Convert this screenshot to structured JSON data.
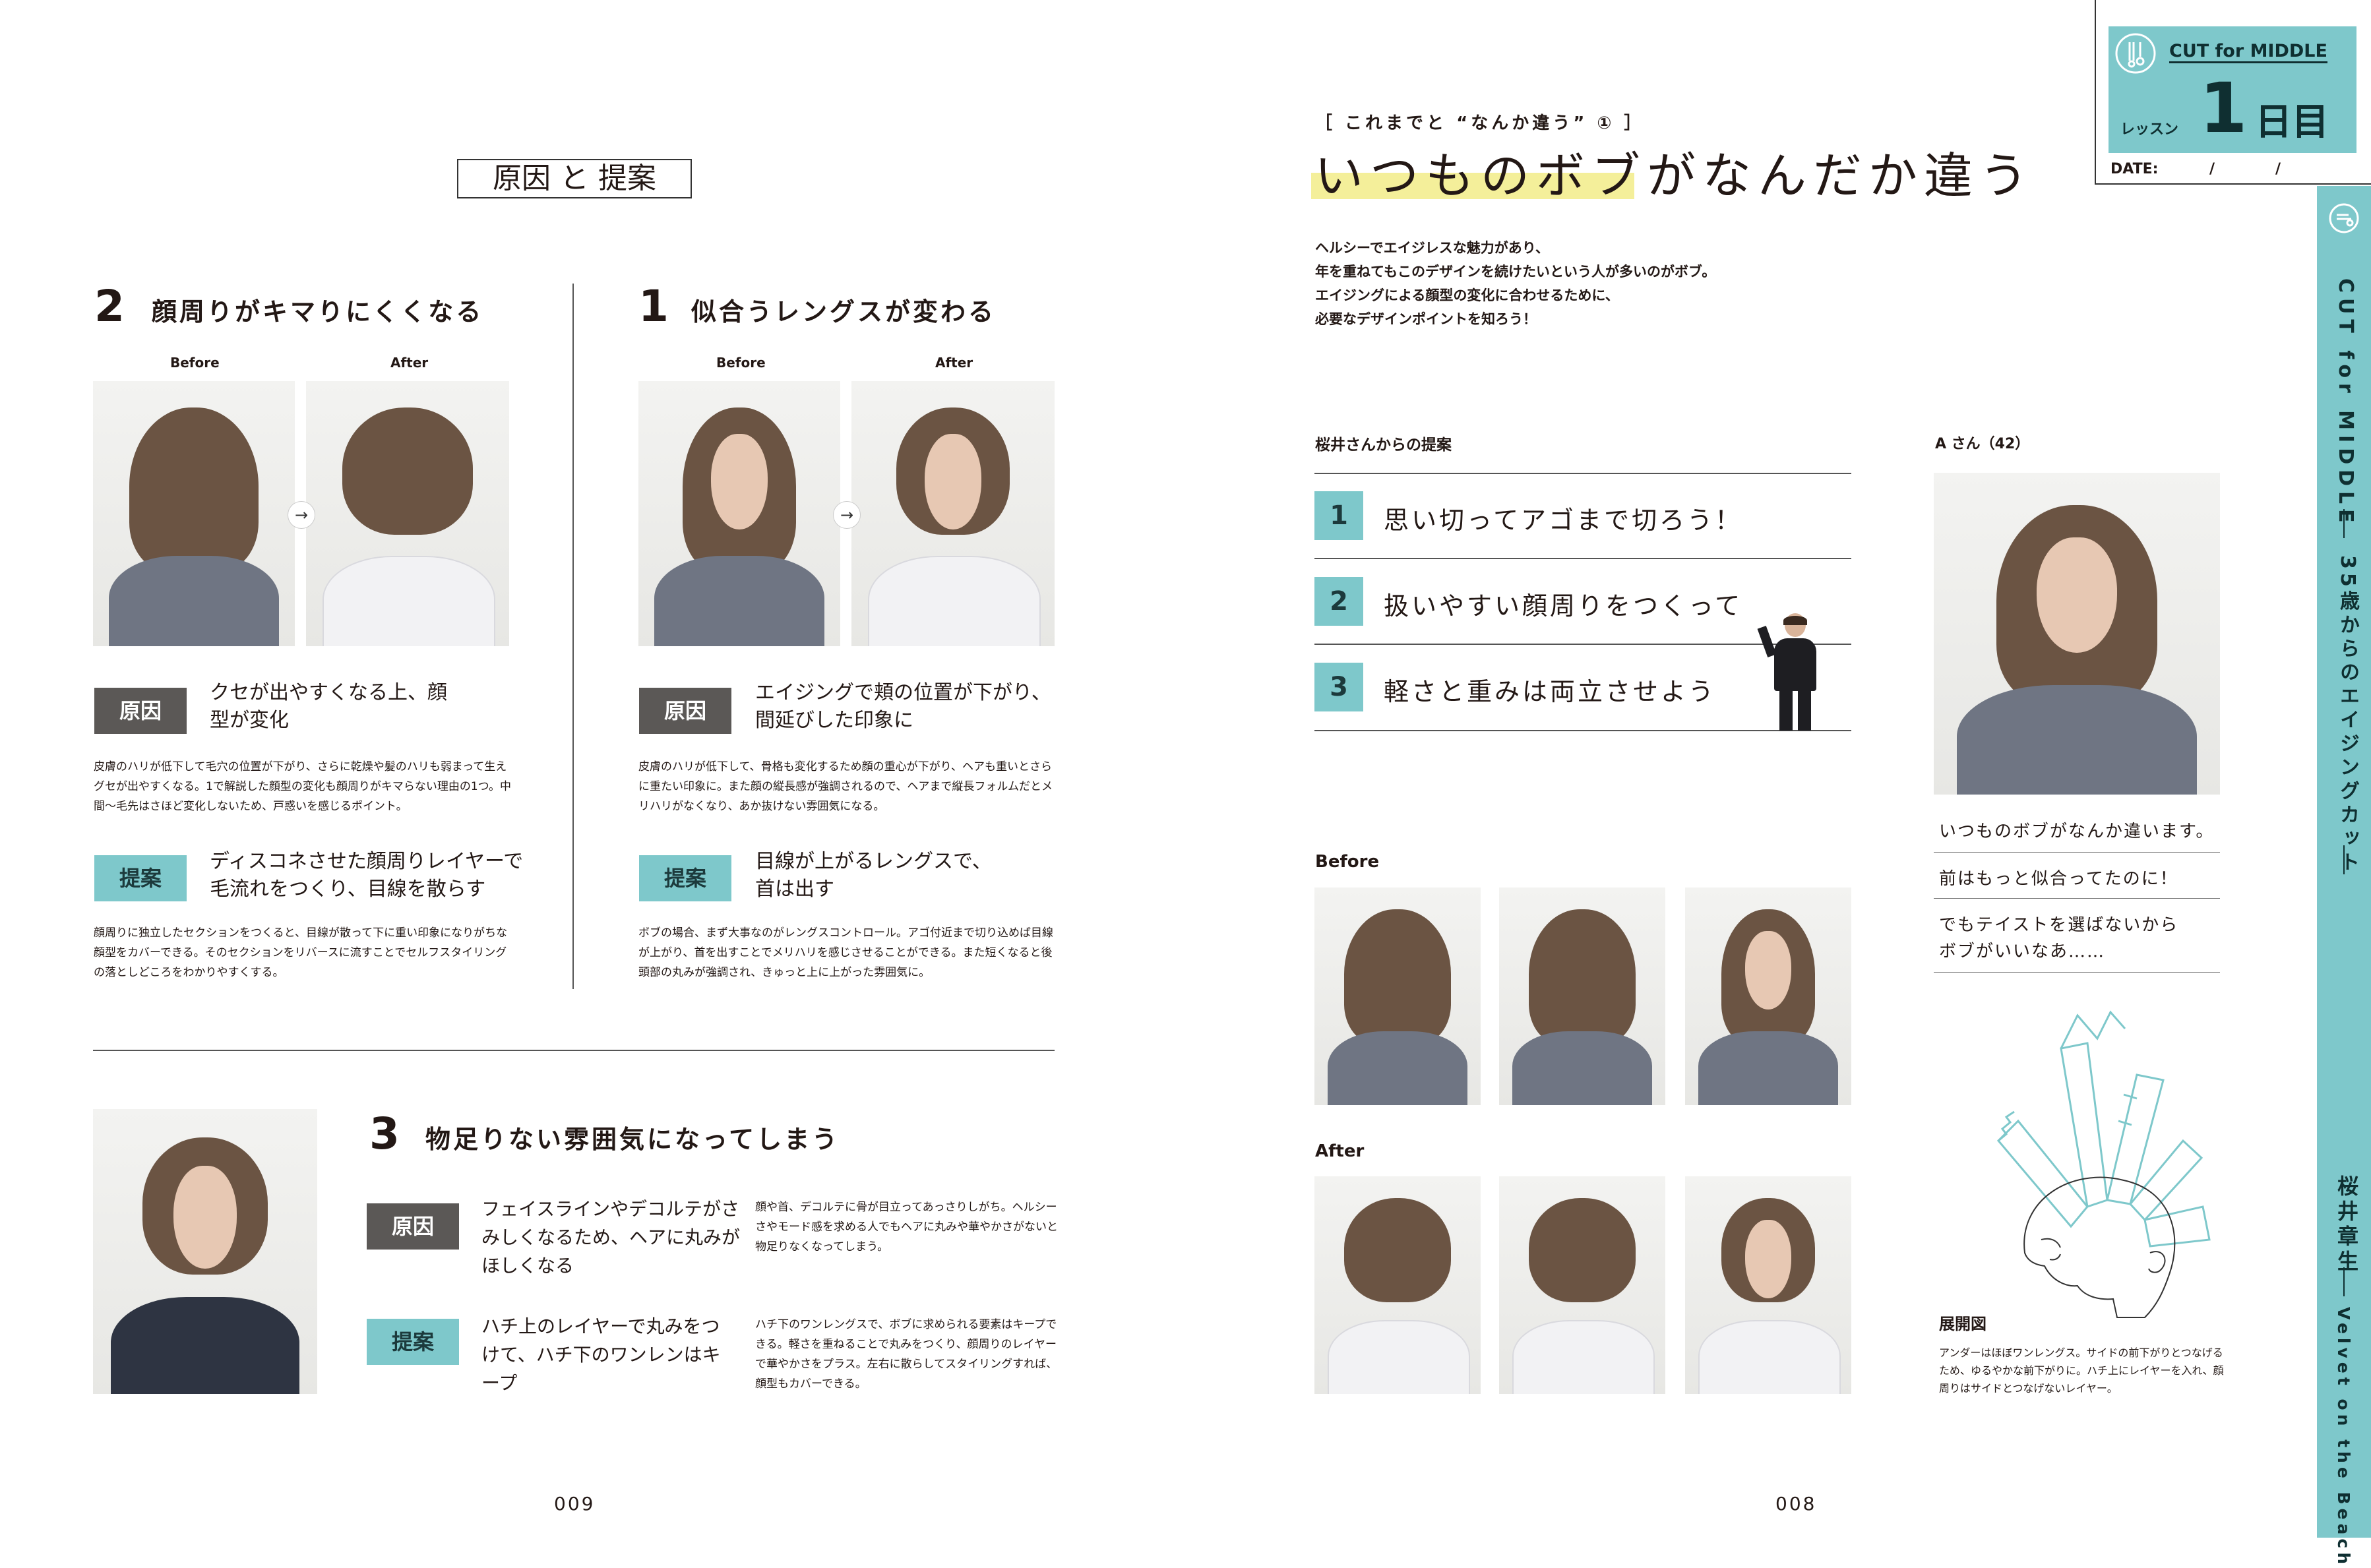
{
  "left_page": {
    "box_title": "原因 と 提案",
    "sec2": {
      "num": "2",
      "title": "顔周りがキマりにくくなる",
      "before": "Before",
      "after": "After",
      "cause_tag": "原因",
      "cause_text": "クセが出やすくなる上、顔型が変化",
      "cause_desc": "皮膚のハリが低下して毛穴の位置が下がり、さらに乾燥や髪のハリも弱まって生えグセが出やすくなる。1で解説した顔型の変化も顔周りがキマらない理由の1つ。中間～毛先はさほど変化しないため、戸惑いを感じるポイント。",
      "proposal_tag": "提案",
      "proposal_text": "ディスコネさせた顔周りレイヤーで毛流れをつくり、目線を散らす",
      "proposal_desc": "顔周りに独立したセクションをつくると、目線が散って下に重い印象になりがちな顔型をカバーできる。そのセクションをリバースに流すことでセルフスタイリングの落としどころをわかりやすくする。"
    },
    "sec1": {
      "num": "1",
      "title": "似合うレングスが変わる",
      "before": "Before",
      "after": "After",
      "cause_tag": "原因",
      "cause_text": "エイジングで頬の位置が下がり、間延びした印象に",
      "cause_desc": "皮膚のハリが低下して、骨格も変化するため顔の重心が下がり、ヘアも重いとさらに重たい印象に。また顔の縦長感が強調されるので、ヘアまで縦長フォルムだとメリハリがなくなり、あか抜けない雰囲気になる。",
      "proposal_tag": "提案",
      "proposal_text": "目線が上がるレングスで、首は出す",
      "proposal_desc": "ボブの場合、まず大事なのがレングスコントロール。アゴ付近まで切り込めば目線が上がり、首を出すことでメリハリを感じさせることができる。また短くなると後頭部の丸みが強調され、きゅっと上に上がった雰囲気に。"
    },
    "sec3": {
      "num": "3",
      "title": "物足りない雰囲気になってしまう",
      "cause_tag": "原因",
      "cause_text": "フェイスラインやデコルテがさみしくなるため、ヘアに丸みがほしくなる",
      "cause_desc": "顔や首、デコルテに骨が目立ってあっさりしがち。ヘルシーさやモード感を求める人でもヘアに丸みや華やかさがないと物足りなくなってしまう。",
      "proposal_tag": "提案",
      "proposal_text": "ハチ上のレイヤーで丸みをつけて、ハチ下のワンレンはキープ",
      "proposal_desc": "ハチ下のワンレングスで、ボブに求められる要素はキープできる。軽さを重ねることで丸みをつくり、顔周りのレイヤーで華やかさをプラス。左右に散らしてスタイリングすれば、顔型もカバーできる。"
    },
    "page_number": "009"
  },
  "right_page": {
    "kicker": "［ これまでと “なんか違う” ① ］",
    "title": "いつものボブがなんだか違う",
    "lead": [
      "ヘルシーでエイジレスな魅力があり、",
      "年を重ねてもこのデザインを続けたいという人が多いのがボブ。",
      "エイジングによる顔型の変化に合わせるために、",
      "必要なデザインポイントを知ろう！"
    ],
    "proposals_heading": "桜井さんからの提案",
    "proposals": [
      {
        "num": "1",
        "text": "思い切ってアゴまで切ろう！"
      },
      {
        "num": "2",
        "text": "扱いやすい顔周りをつくって"
      },
      {
        "num": "3",
        "text": "軽さと重みは両立させよう"
      }
    ],
    "before_label": "Before",
    "after_label": "After",
    "model_label": "A さん（42）",
    "quotes": [
      "いつものボブがなんか違います。",
      "前はもっと似合ってたのに！",
      "でもテイストを選ばないから",
      "ボブがいいなあ……"
    ],
    "diagram_label": "展開図",
    "diagram_desc": "アンダーはほぼワンレングス。サイドの前下がりとつなげるため、ゆるやかな前下がりに。ハチ上にレイヤーを入れ、顔周りはサイドとつなげないレイヤー。",
    "page_number": "008"
  },
  "corner_badge": {
    "series": "CUT for MIDDLE",
    "lesson_label": "レッスン",
    "lesson_num": "1",
    "lesson_unit": "日目",
    "date_label": "DATE:",
    "date_sep1": "/",
    "date_sep2": "/"
  },
  "side_tab": {
    "series": "CUT for MIDDLE",
    "subtitle": "35歳からのエイジングカット",
    "author": "桜井章生",
    "salon": "Velvet on the Beach"
  },
  "colors": {
    "teal": "#7ec8cb",
    "gray_tag": "#5b5856",
    "highlight": "#f4ef9a"
  }
}
